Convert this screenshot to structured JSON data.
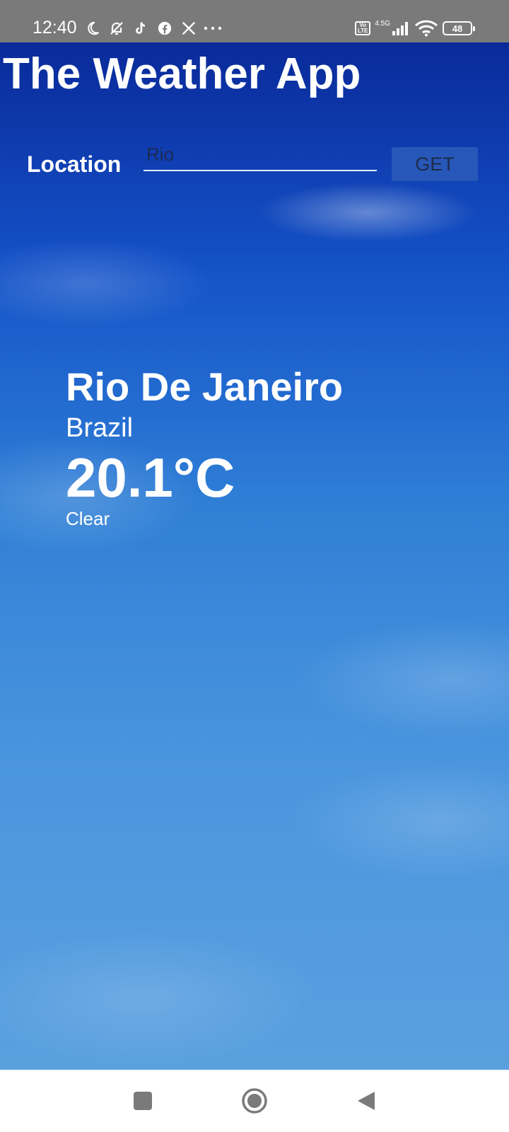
{
  "status_bar": {
    "time": "12:40",
    "left_icons": [
      "moon-icon",
      "bell-off-icon",
      "tiktok-icon",
      "facebook-icon",
      "x-icon",
      "more-icon"
    ],
    "volte_label": "Vo\nLTE",
    "network_type": "4.5G",
    "battery_level": "48"
  },
  "app": {
    "title": "The Weather App",
    "location_label": "Location",
    "location_input_value": "Rio",
    "get_button_label": "GET",
    "colors": {
      "sky_top": "#0a2a9a",
      "sky_bottom": "#5aa0df",
      "button_bg": "#2757b8"
    }
  },
  "weather": {
    "city": "Rio De Janeiro",
    "country": "Brazil",
    "temperature": "20.1°C",
    "condition": "Clear"
  },
  "nav_bar": {
    "buttons": [
      "recents-square-icon",
      "home-circle-icon",
      "back-triangle-icon"
    ]
  }
}
